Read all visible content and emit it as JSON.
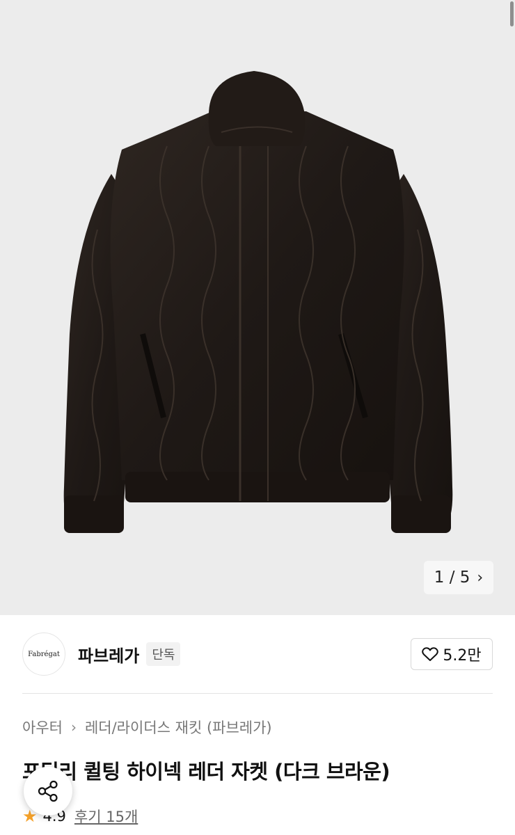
{
  "gallery": {
    "current": "1",
    "total": "5",
    "separator": "/"
  },
  "brand": {
    "logo_text": "Fabrégat",
    "name": "파브레가",
    "badge": "단독",
    "likes": "5.2만"
  },
  "breadcrumb": {
    "category": "아우터",
    "subcategory": "레더/라이더스 재킷 (파브레가)"
  },
  "product": {
    "title": "포딜리 퀼팅 하이넥 레더 자켓 (다크 브라운)"
  },
  "rating": {
    "score": "4.9",
    "reviews": "후기 15개"
  },
  "icons": {
    "chevron": "chevron-right-icon",
    "heart": "heart-outline-icon",
    "star": "star-icon",
    "share": "share-icon"
  },
  "colors": {
    "star": "#f4a12a",
    "jacket": "#241d19",
    "background": "#ececec"
  }
}
